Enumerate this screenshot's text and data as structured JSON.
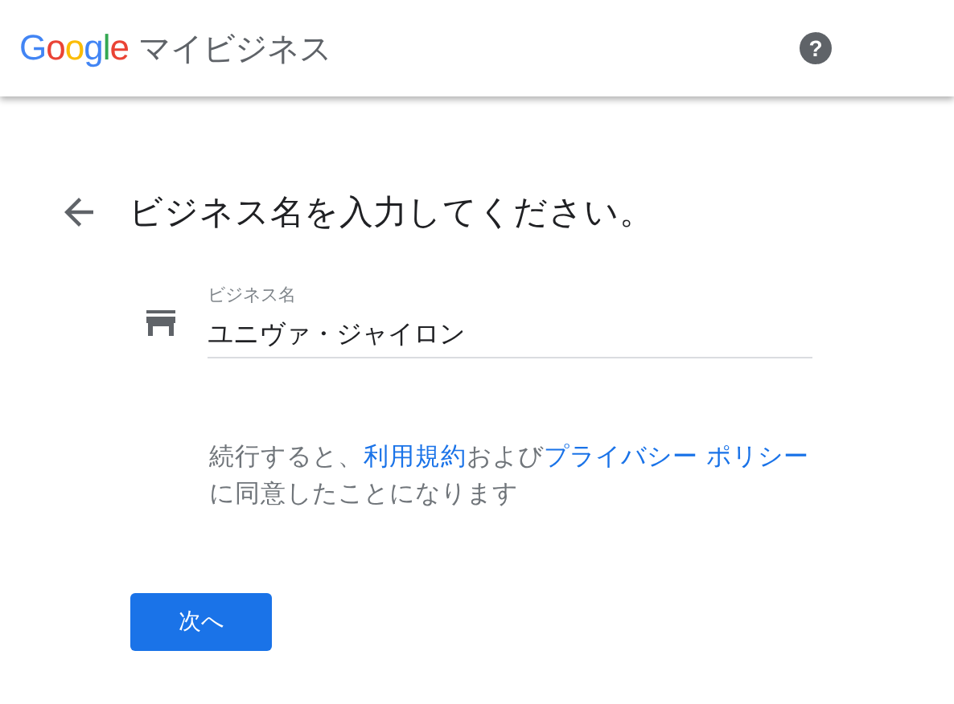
{
  "header": {
    "logo": "Google",
    "product": "マイビジネス",
    "help": "?"
  },
  "heading": "ビジネス名を入力してください。",
  "field": {
    "label": "ビジネス名",
    "value": "ユニヴァ・ジャイロン"
  },
  "terms": [
    {
      "kind": "text",
      "text": "続行すると、"
    },
    {
      "kind": "link",
      "text": "利用規約"
    },
    {
      "kind": "text",
      "text": "および"
    },
    {
      "kind": "link",
      "text": "プライバシー ポリシー"
    },
    {
      "kind": "text",
      "text": "に同意したことになります"
    }
  ],
  "button": "次へ"
}
